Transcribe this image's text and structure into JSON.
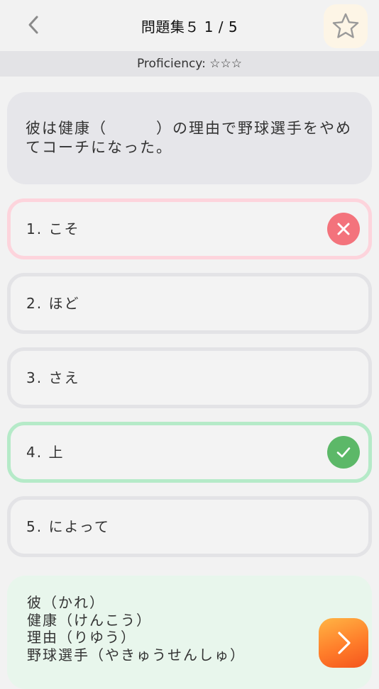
{
  "header": {
    "title": "問題集５ 1 / 5",
    "back_icon": "chevron-left-icon",
    "favorite_icon": "star-outline-icon"
  },
  "proficiency": {
    "text": "Proficiency: ☆☆☆",
    "stars": 0,
    "max_stars": 3
  },
  "question": {
    "text": "彼は健康（　　　）の理由で野球選手をやめてコーチになった。"
  },
  "options": [
    {
      "label": "1.  こそ",
      "state": "wrong",
      "icon": "close-icon"
    },
    {
      "label": "2.  ほど",
      "state": "neutral"
    },
    {
      "label": "3.  さえ",
      "state": "neutral"
    },
    {
      "label": "4.  上",
      "state": "correct",
      "icon": "check-icon"
    },
    {
      "label": "5.  によって",
      "state": "neutral"
    }
  ],
  "readings": [
    "彼（かれ）",
    "健康（けんこう）",
    "理由（りゆう）",
    "野球選手（やきゅうせんしゅ）"
  ],
  "colors": {
    "wrong_border": "#fdd4dc",
    "wrong_icon": "#f3737c",
    "correct_border": "#b5eac8",
    "correct_icon": "#5cb868",
    "next_button": "#ff7d2a",
    "reading_background": "#e8f6ec"
  },
  "next_button_icon": "chevron-right-icon"
}
